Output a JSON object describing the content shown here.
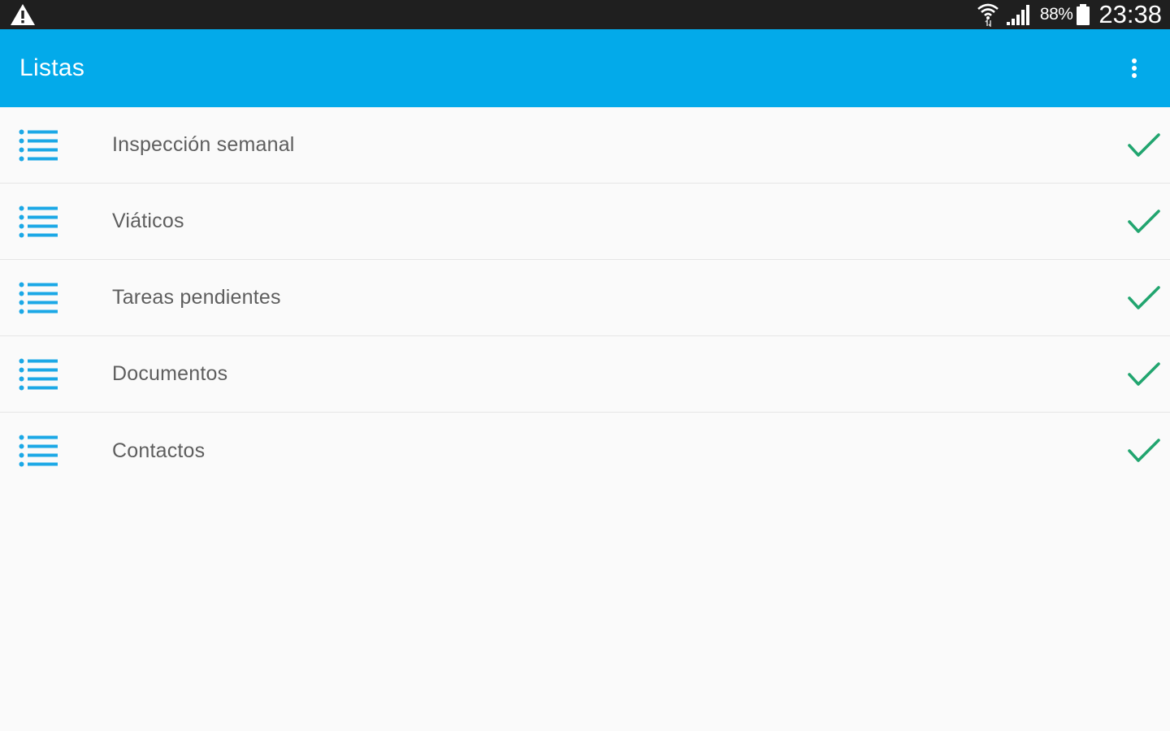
{
  "status_bar": {
    "battery_percent": "88%",
    "time": "23:38",
    "icons": [
      "warning-icon",
      "wifi-icon",
      "signal-icon",
      "battery-icon"
    ]
  },
  "app_bar": {
    "title": "Listas",
    "menu_icon": "overflow-menu-icon",
    "background": "#03aaea"
  },
  "lists": {
    "items": [
      {
        "label": "Inspección semanal",
        "icon": "list-icon",
        "status_icon": "check-icon"
      },
      {
        "label": "Viáticos",
        "icon": "list-icon",
        "status_icon": "check-icon"
      },
      {
        "label": "Tareas pendientes",
        "icon": "list-icon",
        "status_icon": "check-icon"
      },
      {
        "label": "Documentos",
        "icon": "list-icon",
        "status_icon": "check-icon"
      },
      {
        "label": "Contactos",
        "icon": "list-icon",
        "status_icon": "check-icon"
      }
    ]
  },
  "colors": {
    "status_bar": "#1f1f1f",
    "accent": "#03aaea",
    "list_icon": "#1ba8e6",
    "check": "#21a56f",
    "text": "#5e5e5e"
  }
}
